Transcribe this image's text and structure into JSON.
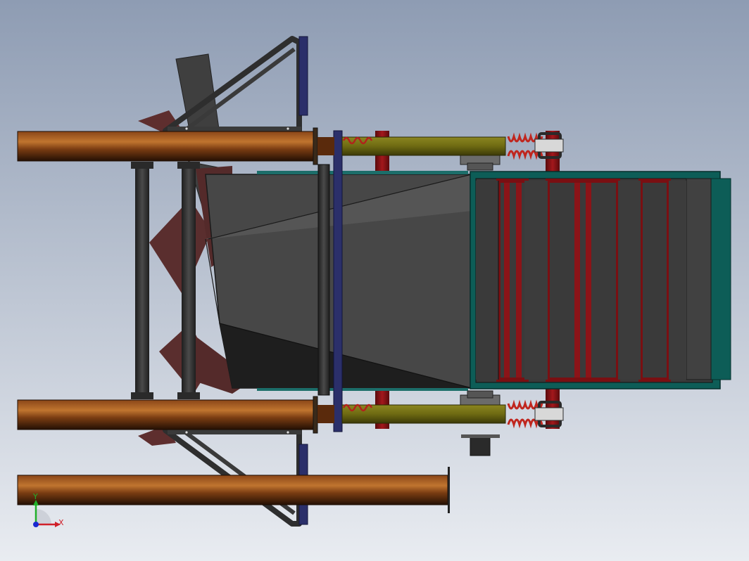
{
  "viewport": {
    "background_top": "#8e9cb3",
    "background_bottom": "#e9ecf1"
  },
  "colors": {
    "pipe_light": "#b9692c",
    "pipe_mid": "#7a3c12",
    "pipe_dark": "#2a1206",
    "frame": "#3a3a3a",
    "frame_dark": "#1f1f1f",
    "hopper": "#4a4a4a",
    "hopper_dark": "#232323",
    "blade": "#5a2e2e",
    "olive": "#6e6a12",
    "spring": "#b2221c",
    "teal": "#0c5a54",
    "maroon": "#7a0f12",
    "navy": "#2b2f6a",
    "screen_bar": "#3c3c3c"
  },
  "triad": {
    "x_label": "X",
    "y_label": "Y",
    "x_color": "#d0202a",
    "y_color": "#20b02a",
    "origin_color": "#1a2ad0"
  }
}
